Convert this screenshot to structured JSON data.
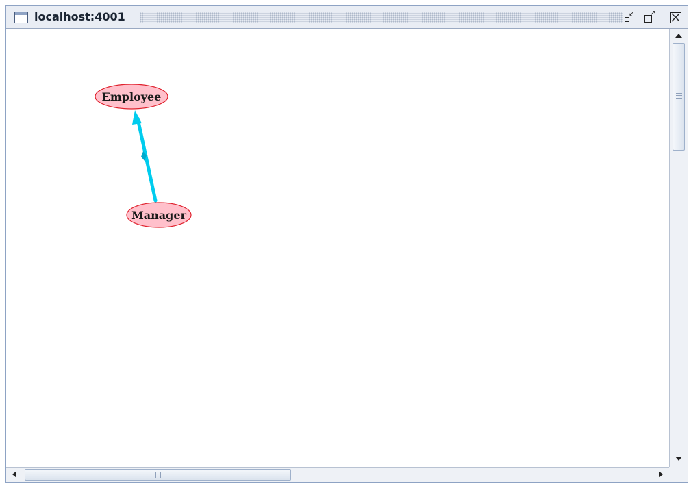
{
  "window": {
    "title": "localhost:4001",
    "buttons": [
      "minimize-icon",
      "maximize-icon",
      "close-icon"
    ]
  },
  "graph": {
    "nodes": [
      {
        "id": "employee",
        "label": "Employee"
      },
      {
        "id": "manager",
        "label": "Manager"
      }
    ],
    "edges": [
      {
        "from": "manager",
        "to": "employee",
        "color": "#00ccee"
      }
    ],
    "node_fill": "#ffc0cb",
    "node_stroke": "#e0232f"
  },
  "colors": {
    "titlebar": "#e9edf4",
    "scrollbar_thumb": "#dbe3ee"
  }
}
